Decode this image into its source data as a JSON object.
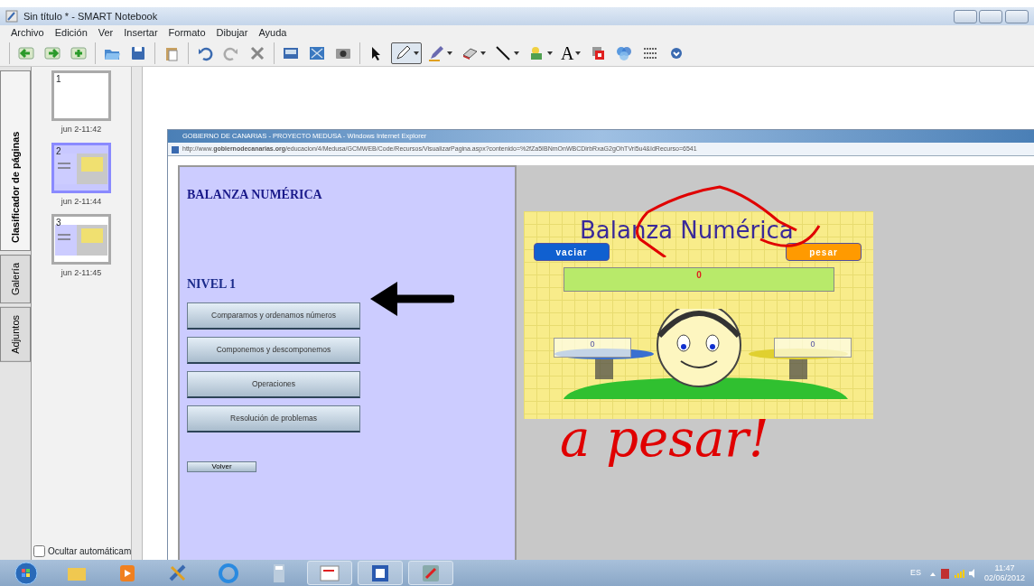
{
  "window": {
    "title": "Sin título * - SMART Notebook"
  },
  "menu": [
    "Archivo",
    "Edición",
    "Ver",
    "Insertar",
    "Formato",
    "Dibujar",
    "Ayuda"
  ],
  "toolbar": [
    [
      {
        "kind": "back",
        "selected": false,
        "dropdown": false
      },
      {
        "kind": "forward",
        "selected": false,
        "dropdown": false
      },
      {
        "kind": "add",
        "selected": false,
        "dropdown": false
      }
    ],
    [
      {
        "kind": "open",
        "selected": false,
        "dropdown": false
      },
      {
        "kind": "save",
        "selected": false,
        "dropdown": false
      }
    ],
    [
      {
        "kind": "paste",
        "selected": false,
        "dropdown": false
      }
    ],
    [
      {
        "kind": "undo",
        "selected": false,
        "dropdown": false
      },
      {
        "kind": "redo",
        "selected": false,
        "dropdown": false
      },
      {
        "kind": "delete",
        "selected": false,
        "dropdown": false
      }
    ],
    [
      {
        "kind": "shade",
        "selected": false,
        "dropdown": false
      },
      {
        "kind": "fullscreen",
        "selected": false,
        "dropdown": false
      },
      {
        "kind": "camera",
        "selected": false,
        "dropdown": false
      }
    ],
    [
      {
        "kind": "select",
        "selected": false,
        "dropdown": false
      },
      {
        "kind": "pen",
        "selected": true,
        "dropdown": true
      },
      {
        "kind": "creative",
        "selected": false,
        "dropdown": true
      },
      {
        "kind": "eraser",
        "selected": false,
        "dropdown": true
      },
      {
        "kind": "line",
        "selected": false,
        "dropdown": true
      },
      {
        "kind": "shape",
        "selected": false,
        "dropdown": true
      },
      {
        "kind": "text",
        "glyph": "A",
        "selected": false,
        "dropdown": true
      },
      {
        "kind": "fill",
        "selected": false,
        "dropdown": false
      },
      {
        "kind": "properties",
        "selected": false,
        "dropdown": false
      },
      {
        "kind": "more",
        "selected": false,
        "dropdown": false
      },
      {
        "kind": "down",
        "selected": false,
        "dropdown": false
      }
    ]
  ],
  "side_tabs": [
    {
      "label": "Clasificador de páginas",
      "selected": true
    },
    {
      "label": "Galería",
      "selected": false
    },
    {
      "label": "Adjuntos",
      "selected": false
    }
  ],
  "pages": [
    {
      "number": "1",
      "time": "jun 2-11:42",
      "selected": false
    },
    {
      "number": "2",
      "time": "jun 2-11:44",
      "selected": true
    },
    {
      "number": "3",
      "time": "jun 2-11:45",
      "selected": false
    }
  ],
  "auto_hide": {
    "label": "Ocultar automáticam",
    "checked": false
  },
  "browser": {
    "title": "GOBIERNO DE CANARIAS - PROYECTO MEDUSA - Windows Internet Explorer",
    "url": "http://www.**gobiernodecanarias.org**/educacion/4/Medusa/GCMWEB/Code/Recursos/VisualizarPagina.aspx?contenido=%2fZa5IBNmOnWBCDirbRxaG2gOhTVri5u4&IdRecurso=6541"
  },
  "page": {
    "heading": "BALANZA NUMÉRICA",
    "level": "NIVEL 1",
    "buttons": [
      "Comparamos y ordenamos números",
      "Componemos y descomponemos",
      "Operaciones",
      "Resolución de problemas"
    ],
    "back": "Volver"
  },
  "game": {
    "title": "Balanza Numérica",
    "empty_button": "vaciar",
    "weigh_button": "pesar",
    "result": "0",
    "left_pan": "0",
    "right_pan": "0"
  },
  "ink_text": "a pesar!",
  "taskbar": [
    {
      "kind": "start",
      "open": false
    },
    {
      "kind": "folder",
      "open": false
    },
    {
      "kind": "media",
      "open": false
    },
    {
      "kind": "tools",
      "open": false
    },
    {
      "kind": "browser",
      "open": false
    },
    {
      "kind": "calculator",
      "open": false
    },
    {
      "kind": "notebook",
      "open": true
    },
    {
      "kind": "word",
      "open": true
    },
    {
      "kind": "board",
      "open": true
    }
  ],
  "tray": {
    "language": "ES",
    "time": "11:47",
    "date": "02/06/2012"
  }
}
